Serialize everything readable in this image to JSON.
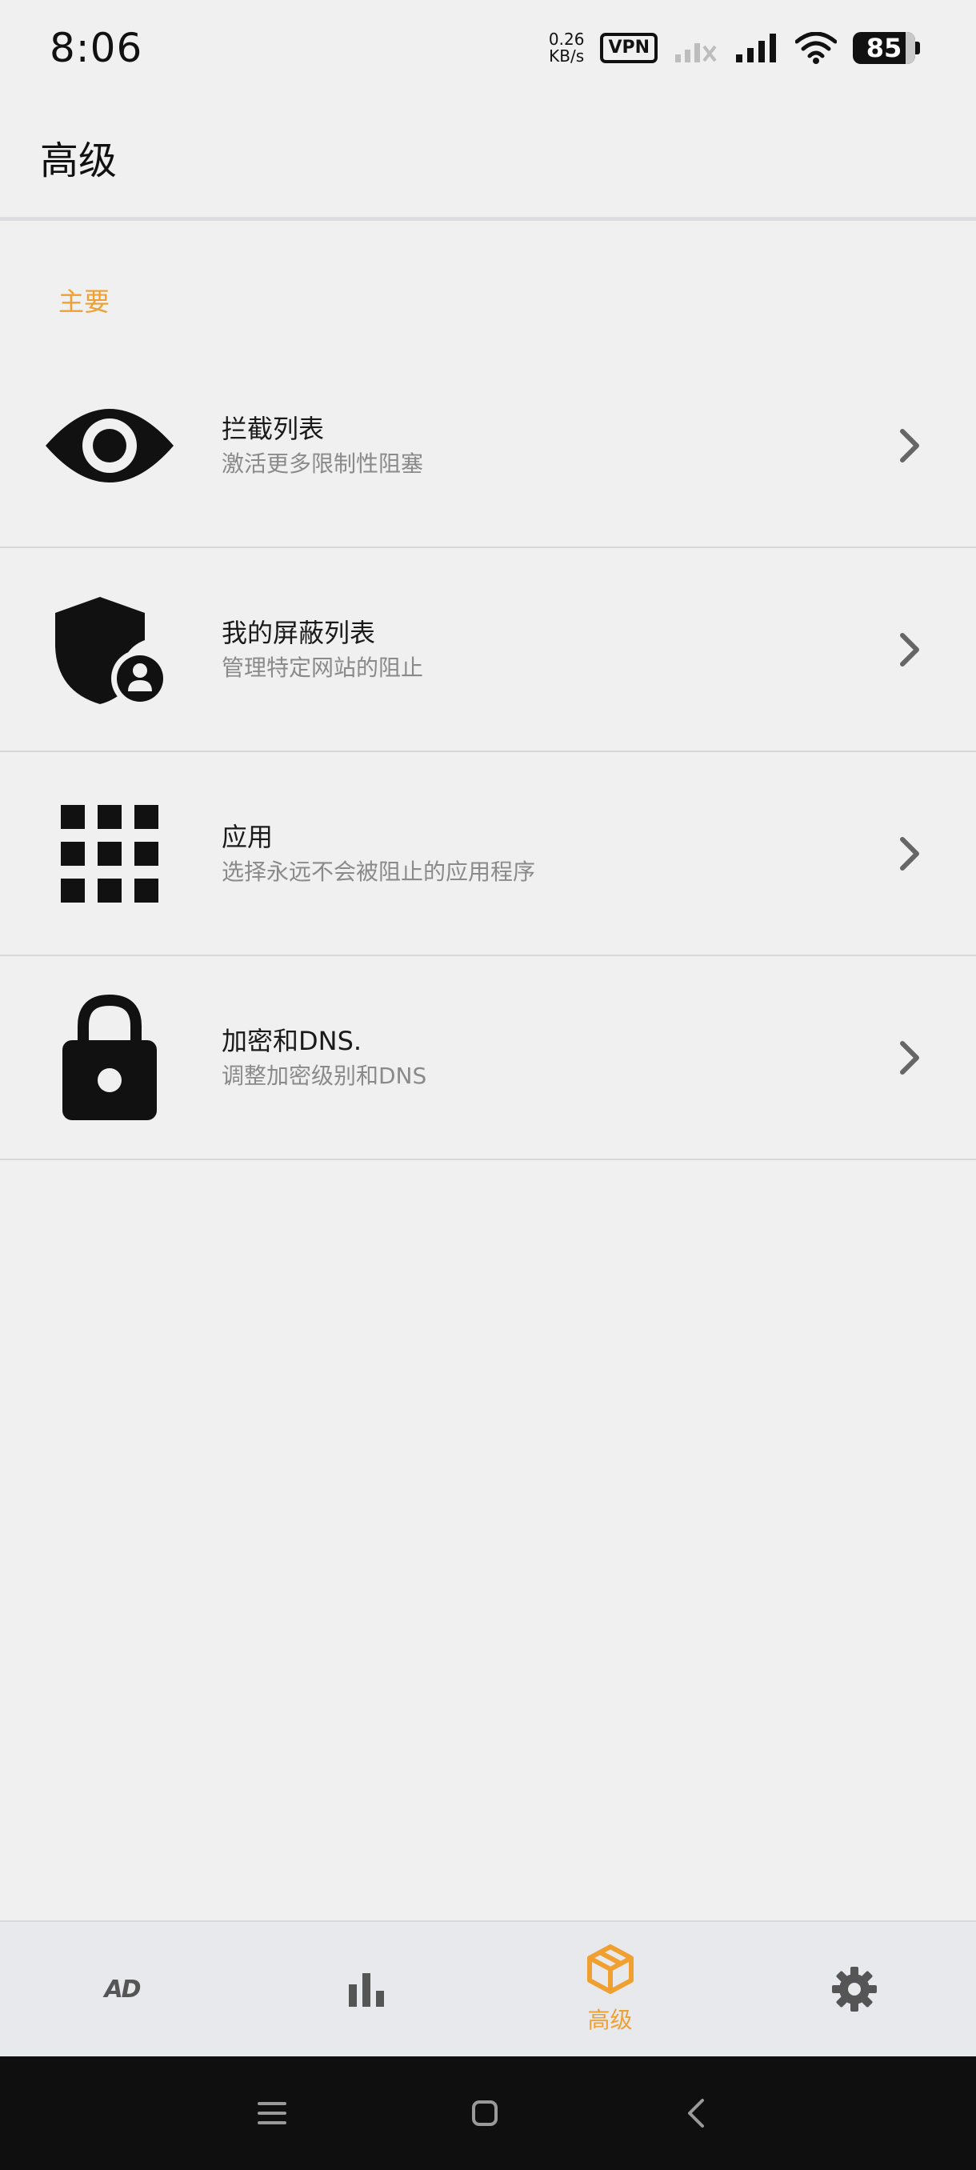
{
  "status_bar": {
    "time": "8:06",
    "net_speed_value": "0.26",
    "net_speed_unit": "KB/s",
    "vpn_label": "VPN",
    "battery_level": "85"
  },
  "app_bar": {
    "title": "高级"
  },
  "section": {
    "header": "主要"
  },
  "menu": {
    "items": [
      {
        "icon": "eye-icon",
        "title": "拦截列表",
        "subtitle": "激活更多限制性阻塞"
      },
      {
        "icon": "shield-user-icon",
        "title": "我的屏蔽列表",
        "subtitle": "管理特定网站的阻止"
      },
      {
        "icon": "grid-apps-icon",
        "title": "应用",
        "subtitle": "选择永远不会被阻止的应用程序"
      },
      {
        "icon": "lock-icon",
        "title": "加密和DNS.",
        "subtitle": "调整加密级别和DNS"
      }
    ]
  },
  "bottom_nav": {
    "ad_label": "AD",
    "active_label": "高级",
    "items": [
      "ad-home",
      "stats",
      "advanced",
      "settings"
    ]
  },
  "colors": {
    "accent": "#f0a030",
    "background": "#f0f0f0",
    "nav_background": "#e7e9ec"
  }
}
